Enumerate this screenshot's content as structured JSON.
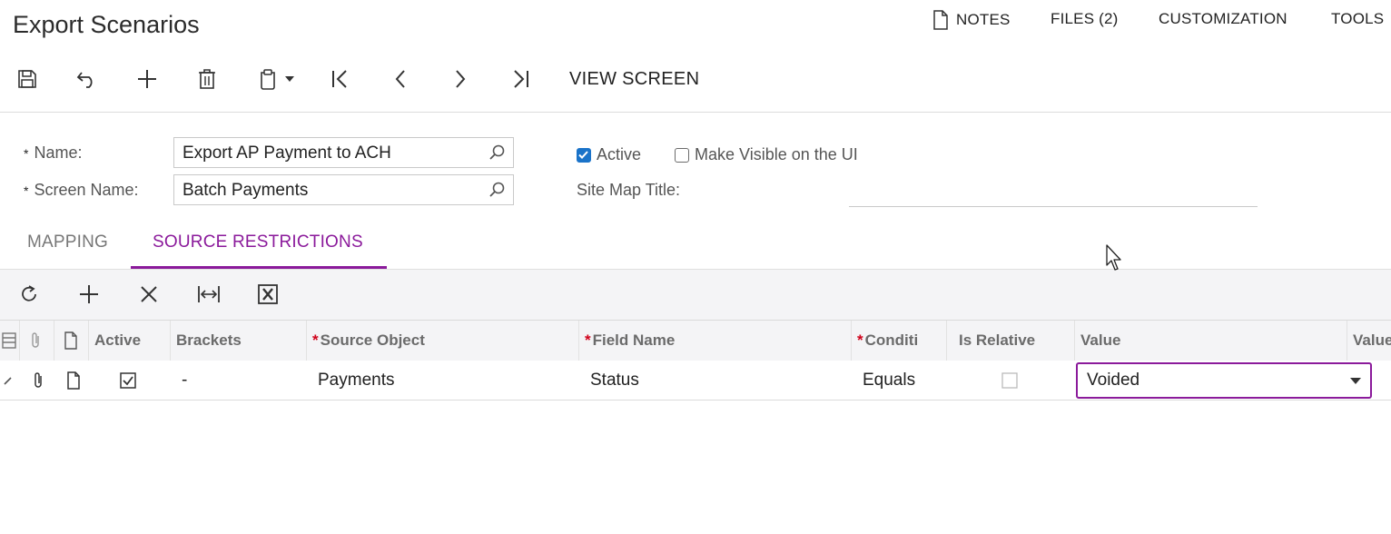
{
  "page": {
    "title": "Export Scenarios"
  },
  "top_nav": {
    "notes": "NOTES",
    "files": "FILES (2)",
    "customization": "CUSTOMIZATION",
    "tools": "TOOLS"
  },
  "toolbar": {
    "icons": [
      "save-icon",
      "undo-icon",
      "add-icon",
      "delete-icon",
      "clipboard-icon",
      "first-icon",
      "previous-icon",
      "next-icon",
      "last-icon"
    ],
    "view_screen": "VIEW SCREEN"
  },
  "form": {
    "name_label": "Name:",
    "name_value": "Export AP Payment to ACH",
    "screen_name_label": "Screen Name:",
    "screen_name_value": "Batch Payments",
    "active_label": "Active",
    "active_checked": true,
    "visible_label": "Make Visible on the UI",
    "visible_checked": false,
    "site_map_title_label": "Site Map Title:",
    "site_map_title_value": ""
  },
  "tabs": [
    {
      "label": "MAPPING",
      "active": false
    },
    {
      "label": "SOURCE RESTRICTIONS",
      "active": true
    }
  ],
  "grid_toolbar": {
    "icons": [
      "refresh-icon",
      "add-row-icon",
      "delete-row-icon",
      "fit-columns-icon",
      "excel-export-icon"
    ]
  },
  "grid": {
    "columns": [
      "Active",
      "Brackets",
      "Source Object",
      "Field Name",
      "Conditi",
      "Is Relative",
      "Value",
      "Value"
    ],
    "rows": [
      {
        "active": true,
        "brackets": "-",
        "source_object": "Payments",
        "field_name": "Status",
        "condition": "Equals",
        "is_relative": false,
        "value": "Voided",
        "value2": ""
      }
    ]
  },
  "colors": {
    "accent": "#8b1a9b",
    "checkbox": "#1a73c9",
    "required": "#d0021b"
  }
}
